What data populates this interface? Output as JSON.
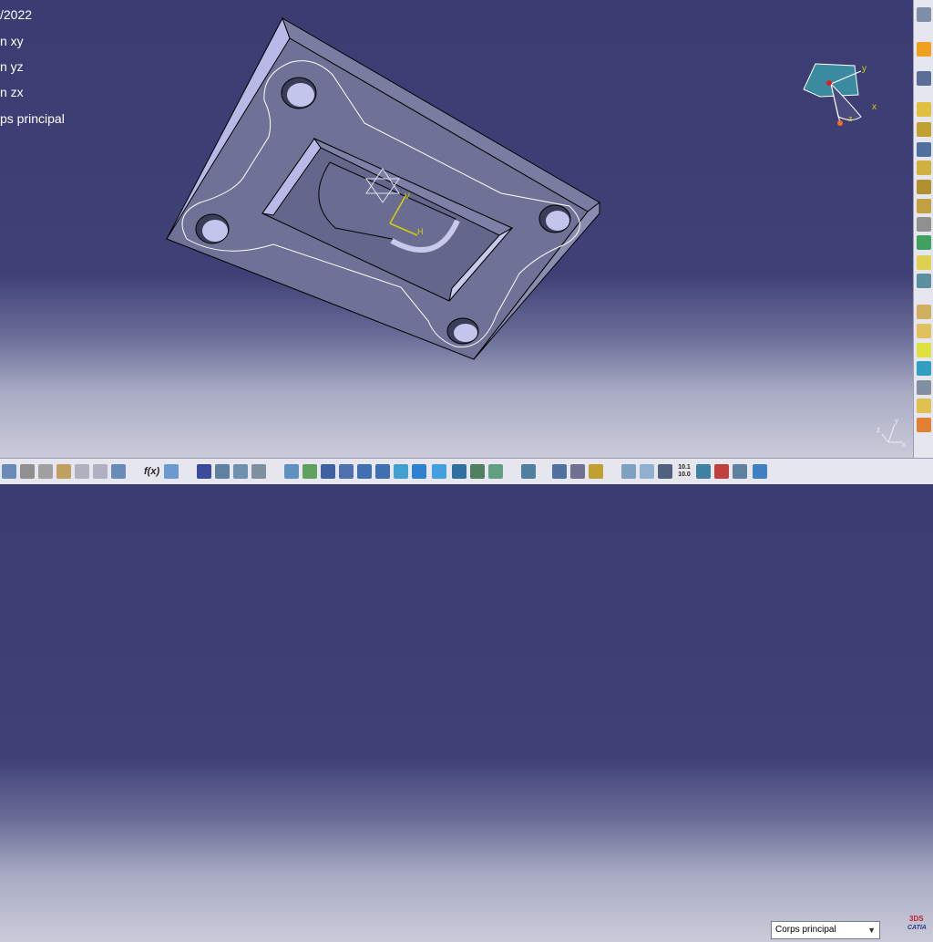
{
  "tree": {
    "date_item": "/2022",
    "plane_xy": "n xy",
    "plane_yz": "n yz",
    "plane_zx": "n zx",
    "main_body": "ps principal"
  },
  "compass": {
    "axis_x": "x",
    "axis_y": "y",
    "axis_z": "z"
  },
  "sketch_axes": {
    "v_label": "V",
    "h_label": "H"
  },
  "mini_axes": {
    "axis_x": "x",
    "axis_y": "y",
    "axis_z": "z"
  },
  "toolbar": {
    "body_select_value": "Corps principal",
    "formula_label": "f(x)",
    "dimension_label_top": "10.1",
    "dimension_label_bottom": "10.0"
  },
  "logo": {
    "brand": "CATIA",
    "mark": "3DS"
  },
  "colors": {
    "background_top": "#3a3c72",
    "background_bottom": "#cfd0dc",
    "part_top_face": "#6f7196",
    "part_side_face": "#b8b9e6",
    "toolbar_bg": "#e6e6ee"
  }
}
